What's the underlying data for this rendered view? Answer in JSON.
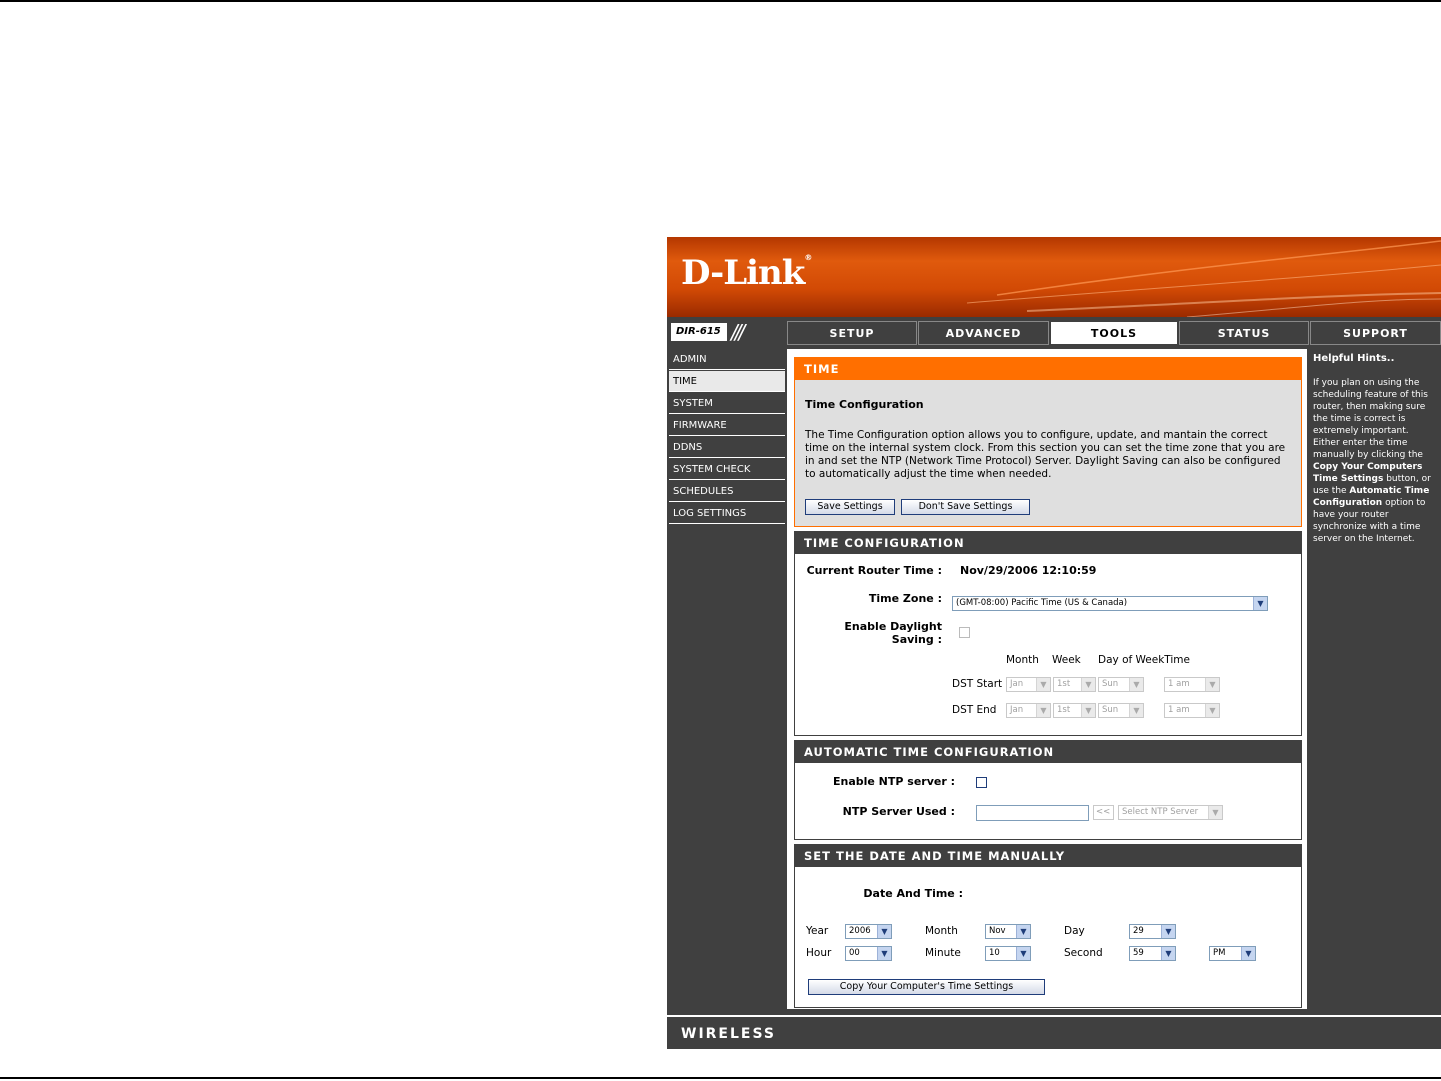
{
  "brand": {
    "logo_text": "D-Link",
    "registered": "®",
    "model": "DIR-615",
    "slashes": "///"
  },
  "nav": {
    "tabs": [
      {
        "label": "SETUP"
      },
      {
        "label": "ADVANCED"
      },
      {
        "label": "TOOLS"
      },
      {
        "label": "STATUS"
      },
      {
        "label": "SUPPORT"
      }
    ],
    "active_tab": "TOOLS"
  },
  "sidebar": {
    "items": [
      {
        "label": "ADMIN"
      },
      {
        "label": "TIME"
      },
      {
        "label": "SYSTEM"
      },
      {
        "label": "FIRMWARE"
      },
      {
        "label": "DDNS"
      },
      {
        "label": "SYSTEM CHECK"
      },
      {
        "label": "SCHEDULES"
      },
      {
        "label": "LOG SETTINGS"
      }
    ],
    "active_item": "TIME"
  },
  "intro": {
    "header": "TIME",
    "title": "Time Configuration",
    "text": "The Time Configuration option allows you to configure, update, and mantain the correct time on the internal system clock. From this section you can set the time zone that you are in and set the NTP (Network Time Protocol) Server. Daylight Saving can also be configured to automatically adjust the time when needed.",
    "save_label": "Save Settings",
    "dont_save_label": "Don't Save Settings"
  },
  "time_config": {
    "header": "TIME CONFIGURATION",
    "current_time_label": "Current Router Time :",
    "current_time_value": "Nov/29/2006 12:10:59",
    "time_zone_label": "Time Zone :",
    "time_zone_value": "(GMT-08:00) Pacific Time (US & Canada)",
    "dst_label_1": "Enable Daylight",
    "dst_label_2": "Saving :",
    "dst_enabled": false,
    "col_month": "Month",
    "col_week": "Week",
    "col_dow_time": "Day of WeekTime",
    "dst_start_label": "DST Start",
    "dst_start": {
      "month": "Jan",
      "week": "1st",
      "day": "Sun",
      "time": "1 am"
    },
    "dst_end_label": "DST End",
    "dst_end": {
      "month": "Jan",
      "week": "1st",
      "day": "Sun",
      "time": "1 am"
    }
  },
  "auto_time": {
    "header": "AUTOMATIC TIME CONFIGURATION",
    "ntp_enable_label": "Enable NTP server :",
    "ntp_enabled": false,
    "ntp_used_label": "NTP Server Used :",
    "ntp_used_value": "",
    "copy_arrow": "<<",
    "ntp_select_value": "Select NTP Server"
  },
  "manual": {
    "header": "SET THE DATE AND TIME MANUALLY",
    "date_time_label": "Date And Time :",
    "year_label": "Year",
    "year_value": "2006",
    "month_label": "Month",
    "month_value": "Nov",
    "day_label": "Day",
    "day_value": "29",
    "hour_label": "Hour",
    "hour_value": "00",
    "minute_label": "Minute",
    "minute_value": "10",
    "second_label": "Second",
    "second_value": "59",
    "ampm_value": "PM",
    "copy_button_label": "Copy Your Computer's Time Settings"
  },
  "hints": {
    "title": "Helpful Hints..",
    "text_1": "If you plan on using the scheduling feature of this router, then making sure the time is correct is extremely important. Either enter the time manually by clicking the ",
    "bold_1": "Copy Your Computers Time Settings",
    "text_2": " button, or use the ",
    "bold_2": "Automatic Time Configuration",
    "text_3": " option to have your router synchronize with a time server on the Internet."
  },
  "footer": {
    "brand": "WIRELESS"
  },
  "colors": {
    "orange": "#ff6f00",
    "dark_gray": "#404040",
    "button_border": "#1f3d7a"
  },
  "icons": {
    "select_arrow": "chevron-down-icon",
    "checkbox": "checkbox-icon"
  }
}
